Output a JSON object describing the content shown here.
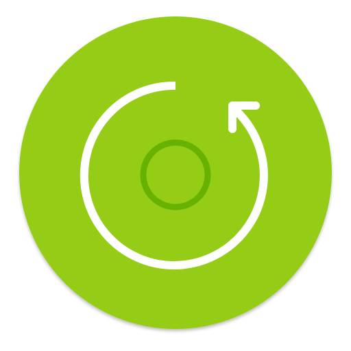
{
  "icon": {
    "name": "rotate-refresh-app-icon",
    "colors": {
      "background": "#ffffff",
      "badge": "#95cc17",
      "shadow": "#000000",
      "arrow": "#ffffff",
      "center_ring": "#65b300"
    }
  }
}
